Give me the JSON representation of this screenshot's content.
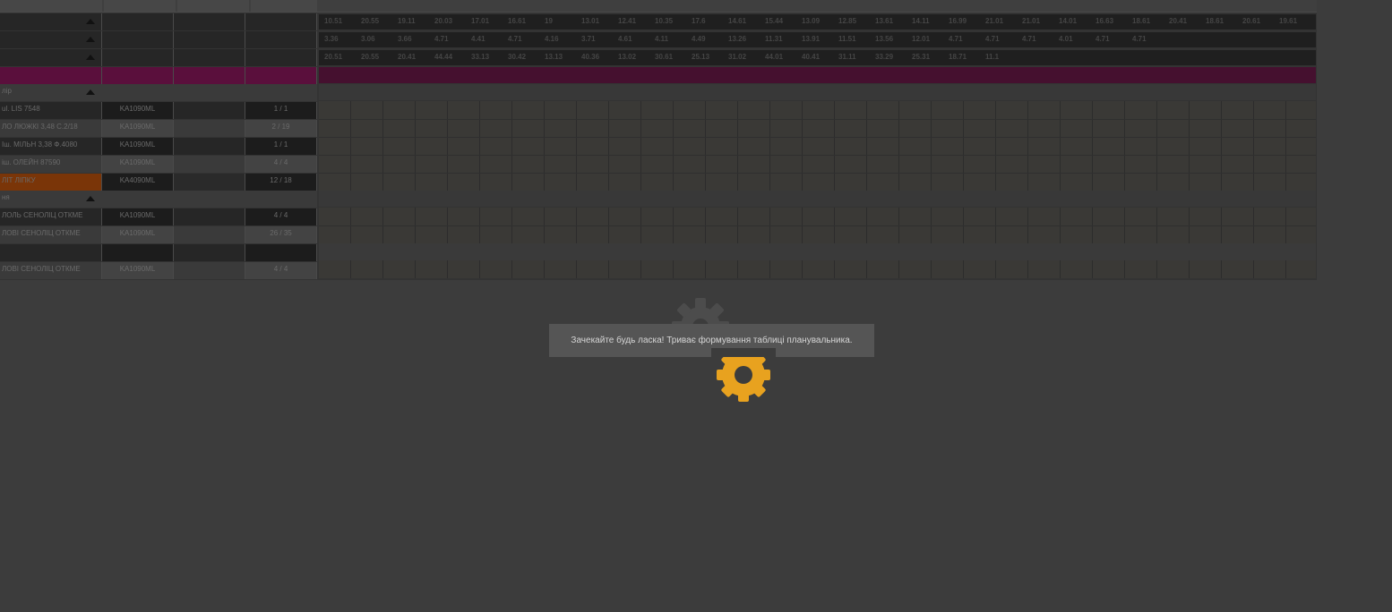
{
  "colors": {
    "background": "#3c3c3c",
    "accent_magenta": "#5a0f3c",
    "selected_orange": "#7a3508",
    "gear_orange": "#e8a21f"
  },
  "header_rows": [
    {
      "label": "",
      "values": [
        "10.51",
        "20.55",
        "19.11",
        "20.03",
        "17.01",
        "16.61",
        "19",
        "13.01",
        "12.41",
        "10.35",
        "17.6",
        "14.61",
        "15.44",
        "13.09",
        "12.85",
        "13.61",
        "14.11",
        "16.99",
        "21.01",
        "21.01",
        "14.01",
        "16.63",
        "18.61",
        "20.41",
        "18.61",
        "20.61",
        "19.61"
      ]
    },
    {
      "label": "",
      "values": [
        "3.36",
        "3.06",
        "3.66",
        "4.71",
        "4.41",
        "4.71",
        "4.16",
        "3.71",
        "4.61",
        "4.11",
        "4.49",
        "13.26",
        "11.31",
        "13.91",
        "11.51",
        "13.56",
        "12.01",
        "4.71",
        "4.71",
        "4.71",
        "4.01",
        "4.71",
        "4.71"
      ]
    },
    {
      "label": "",
      "values": [
        "20.51",
        "20.55",
        "20.41",
        "44.44",
        "33.13",
        "30.42",
        "13.13",
        "40.36",
        "13.02",
        "30.61",
        "25.13",
        "31.02",
        "44.01",
        "40.41",
        "31.11",
        "33.29",
        "25.31",
        "18.71",
        "11.1"
      ]
    }
  ],
  "group_1": {
    "title": "лір",
    "rows": [
      {
        "name": "ul. LIS 7548",
        "code": "KA1090ML",
        "extra": "",
        "value": "1 / 1",
        "selected": false
      },
      {
        "name": "ЛО ЛЮЖКІ 3,48 С.2/18",
        "code": "KA1090ML",
        "extra": "",
        "value": "2 / 19",
        "selected": false
      },
      {
        "name": "Іш. МІЛЬН 3,38 Ф.4080",
        "code": "KA1090ML",
        "extra": "",
        "value": "1 / 1",
        "selected": false
      },
      {
        "name": "іш. ОЛЕЙН 87590",
        "code": "KA1090ML",
        "extra": "",
        "value": "4 / 4",
        "selected": false
      },
      {
        "name": "ЛІТ ЛІПКУ",
        "code": "KA4090ML",
        "extra": "",
        "value": "12 / 18",
        "selected": true
      }
    ]
  },
  "group_2": {
    "title": "ня",
    "rows": [
      {
        "name": "ЛОЛЬ СЕНОЛІЦ ОТКМЕ",
        "code": "KA1090ML",
        "extra": "",
        "value": "4 / 4"
      },
      {
        "name": "ЛОВІ СЕНОЛІЦ ОТКМЕ",
        "code": "KA1090ML",
        "extra": "",
        "value": "26 / 35"
      },
      {
        "name": "",
        "code": "",
        "extra": "",
        "value": ""
      },
      {
        "name": "ЛОВІ СЕНОЛІЦ ОТКМЕ",
        "code": "KA1090ML",
        "extra": "",
        "value": "4 / 4"
      }
    ]
  },
  "loading": {
    "message": "Зачекайте будь ласка! Триває формування таблиці планувальника."
  }
}
